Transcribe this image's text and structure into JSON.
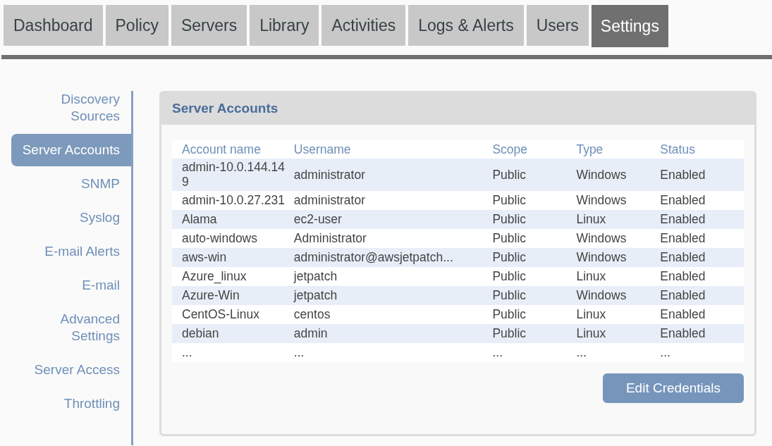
{
  "tabs": [
    {
      "label": "Dashboard",
      "selected": false
    },
    {
      "label": "Policy",
      "selected": false
    },
    {
      "label": "Servers",
      "selected": false
    },
    {
      "label": "Library",
      "selected": false
    },
    {
      "label": "Activities",
      "selected": false
    },
    {
      "label": "Logs & Alerts",
      "selected": false
    },
    {
      "label": "Users",
      "selected": false
    },
    {
      "label": "Settings",
      "selected": true
    }
  ],
  "sidebar": {
    "items": [
      {
        "label": "Discovery Sources",
        "selected": false
      },
      {
        "label": "Server Accounts",
        "selected": true
      },
      {
        "label": "SNMP",
        "selected": false
      },
      {
        "label": "Syslog",
        "selected": false
      },
      {
        "label": "E-mail Alerts",
        "selected": false
      },
      {
        "label": "E-mail",
        "selected": false
      },
      {
        "label": "Advanced Settings",
        "selected": false
      },
      {
        "label": "Server Access",
        "selected": false
      },
      {
        "label": "Throttling",
        "selected": false
      }
    ]
  },
  "panel": {
    "title": "Server Accounts",
    "table": {
      "columns": [
        "Account name",
        "Username",
        "Scope",
        "Type",
        "Status"
      ],
      "rows": [
        [
          "admin-10.0.144.149",
          "administrator",
          "Public",
          "Windows",
          "Enabled"
        ],
        [
          "admin-10.0.27.231",
          "administrator",
          "Public",
          "Windows",
          "Enabled"
        ],
        [
          "Alama",
          "ec2-user",
          "Public",
          "Linux",
          "Enabled"
        ],
        [
          "auto-windows",
          "Administrator",
          "Public",
          "Windows",
          "Enabled"
        ],
        [
          "aws-win",
          "administrator@awsjetpatch...",
          "Public",
          "Windows",
          "Enabled"
        ],
        [
          "Azure_linux",
          "jetpatch",
          "Public",
          "Linux",
          "Enabled"
        ],
        [
          "Azure-Win",
          "jetpatch",
          "Public",
          "Windows",
          "Enabled"
        ],
        [
          "CentOS-Linux",
          "centos",
          "Public",
          "Linux",
          "Enabled"
        ],
        [
          "debian",
          "admin",
          "Public",
          "Linux",
          "Enabled"
        ],
        [
          "...",
          "...",
          "...",
          "...",
          "..."
        ]
      ]
    },
    "button": "Edit Credentials"
  }
}
